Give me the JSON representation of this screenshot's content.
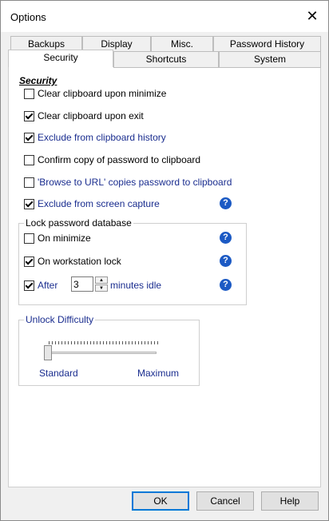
{
  "window": {
    "title": "Options",
    "close_glyph": "✕"
  },
  "tabs": {
    "row1": [
      "Backups",
      "Display",
      "Misc.",
      "Password History"
    ],
    "row2": [
      "Security",
      "Shortcuts",
      "System"
    ],
    "selected": "Security"
  },
  "security": {
    "heading": "Security",
    "items": [
      {
        "label": "Clear clipboard upon minimize",
        "checked": false
      },
      {
        "label": "Clear clipboard upon exit",
        "checked": true
      },
      {
        "label": "Exclude from clipboard history",
        "checked": true
      },
      {
        "label": "Confirm copy of password to clipboard",
        "checked": false
      },
      {
        "label": "'Browse to URL' copies password to clipboard",
        "checked": false
      },
      {
        "label": "Exclude from screen capture",
        "checked": true
      }
    ]
  },
  "lock": {
    "title": "Lock password database",
    "on_minimize": {
      "label": "On minimize",
      "checked": false
    },
    "on_workstation_lock": {
      "label": "On workstation lock",
      "checked": true
    },
    "after": {
      "label": "After",
      "checked": true,
      "value": "3",
      "suffix": "minutes idle"
    }
  },
  "unlock": {
    "title": "Unlock Difficulty",
    "min_label": "Standard",
    "max_label": "Maximum",
    "value_fraction": 0.0
  },
  "help_glyph": "?",
  "buttons": {
    "ok": "OK",
    "cancel": "Cancel",
    "help": "Help"
  }
}
